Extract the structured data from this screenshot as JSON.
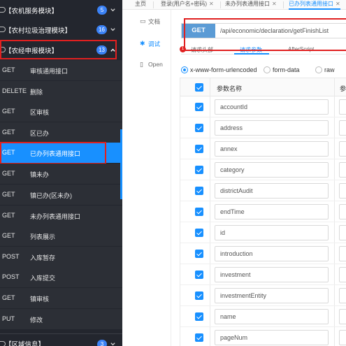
{
  "sidebar": {
    "groups": [
      {
        "label": "【农机服务模块】",
        "count": "5",
        "expanded": false
      },
      {
        "label": "【农村垃圾治理模块】",
        "count": "16",
        "expanded": false
      },
      {
        "label": "【农经申报模块】",
        "count": "13",
        "expanded": true
      },
      {
        "label": "【区域信息】",
        "count": "3",
        "expanded": false
      }
    ],
    "apis": [
      {
        "method": "GET",
        "name": "审核通用接口"
      },
      {
        "method": "DELETE",
        "name": "删除"
      },
      {
        "method": "GET",
        "name": "区审核"
      },
      {
        "method": "GET",
        "name": "区已办"
      },
      {
        "method": "GET",
        "name": "已办列表通用接口",
        "active": true
      },
      {
        "method": "GET",
        "name": "镇未办"
      },
      {
        "method": "GET",
        "name": "镇已办(区未办)"
      },
      {
        "method": "GET",
        "name": "未办列表通用接口"
      },
      {
        "method": "GET",
        "name": "列表展示"
      },
      {
        "method": "POST",
        "name": "入库暂存"
      },
      {
        "method": "POST",
        "name": "入库提交"
      },
      {
        "method": "GET",
        "name": "镇审核"
      },
      {
        "method": "PUT",
        "name": "修改"
      }
    ]
  },
  "tabs": [
    {
      "label": "主页",
      "closable": false
    },
    {
      "label": "登录(用户名+密码)",
      "closable": true
    },
    {
      "label": "未办列表通用接口",
      "closable": true
    },
    {
      "label": "已办列表通用接口",
      "closable": true,
      "active": true
    }
  ],
  "leftnav": [
    {
      "icon": "doc-icon",
      "label": "文档"
    },
    {
      "icon": "debug-icon",
      "label": "调试",
      "active": true
    },
    {
      "icon": "open-icon",
      "label": "Open"
    }
  ],
  "request": {
    "method": "GET",
    "url": "/api/economic/declaration/getFinishList",
    "subtabs": [
      "请求头部",
      "请求参数",
      "AfterScript"
    ],
    "active_subtab": "请求参数",
    "badge": "1",
    "content_types": [
      "x-www-form-urlencoded",
      "form-data",
      "raw"
    ],
    "selected_content_type": "x-www-form-urlencoded"
  },
  "params": {
    "header_name": "参数名称",
    "header_type": "参",
    "rows": [
      "accountId",
      "address",
      "annex",
      "category",
      "districtAudit",
      "endTime",
      "id",
      "introduction",
      "investment",
      "investmentEntity",
      "name",
      "pageNum"
    ]
  },
  "colors": {
    "accent": "#1890ff",
    "sidebar_bg": "#23262e",
    "highlight": "#e02020",
    "method_bg": "#5b9bd5"
  }
}
